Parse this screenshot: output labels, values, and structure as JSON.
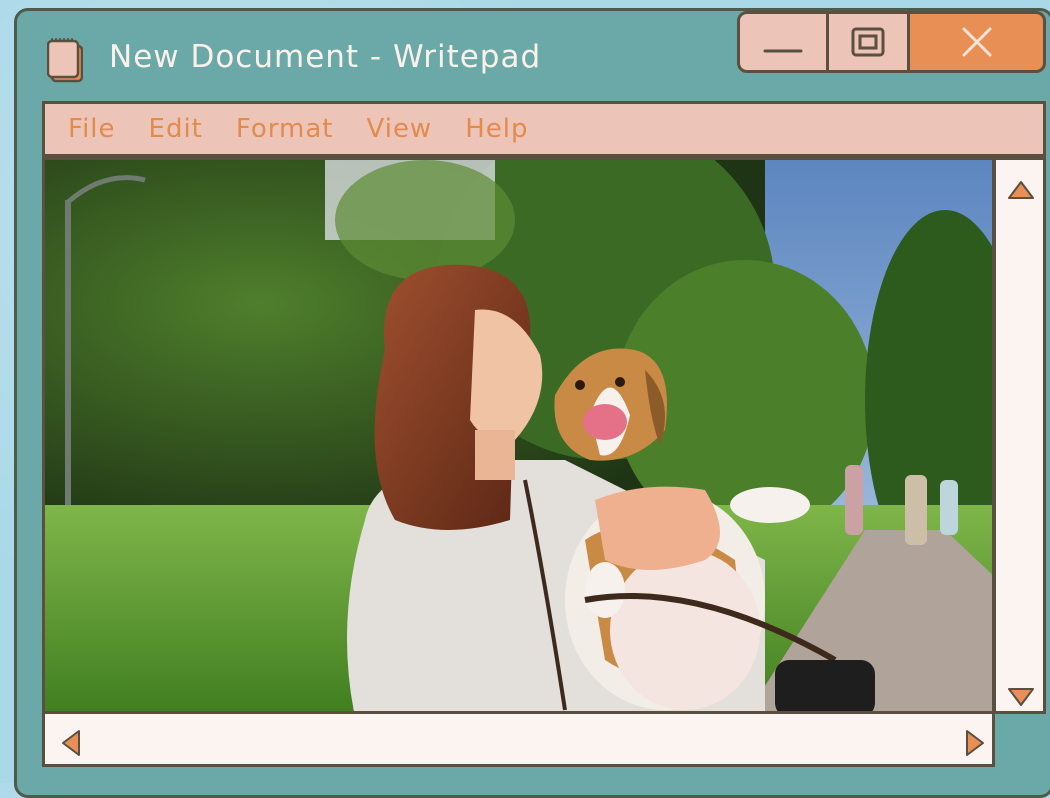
{
  "window": {
    "title": "New Document - Writepad"
  },
  "controls": {
    "minimize": "minimize",
    "maximize": "maximize",
    "close": "close"
  },
  "menu": {
    "items": [
      "File",
      "Edit",
      "Format",
      "View",
      "Help"
    ]
  },
  "content": {
    "image_subject": "woman-kissing-beagle-photo"
  },
  "colors": {
    "window_frame": "#6aa9a7",
    "menubar": "#ecc5b8",
    "accent": "#e78f55",
    "scroll_track": "#fbf4f0",
    "outline": "#5b5040"
  },
  "icons": {
    "app": "notepad-icon",
    "minimize": "minimize-icon",
    "maximize": "maximize-icon",
    "close": "close-icon",
    "scroll_up": "triangle-up-icon",
    "scroll_down": "triangle-down-icon",
    "scroll_left": "triangle-left-icon",
    "scroll_right": "triangle-right-icon"
  }
}
